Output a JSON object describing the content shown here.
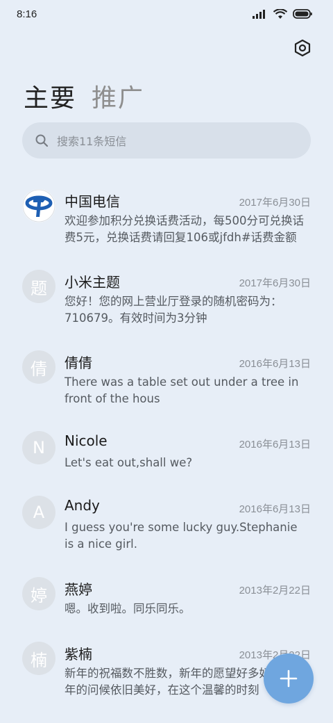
{
  "status_bar": {
    "time": "8:16"
  },
  "tabs": [
    {
      "label": "主要"
    },
    {
      "label": "推广"
    }
  ],
  "search": {
    "placeholder": "搜索11条短信"
  },
  "messages": [
    {
      "name": "中国电信",
      "date": "2017年6月30日",
      "preview": "欢迎参加积分兑换话费活动，每500分可兑换话费5元，兑换话费请回复106或jfdh#话费金额",
      "avatar": "china-telecom-logo"
    },
    {
      "name": "小米主题",
      "date": "2017年6月30日",
      "preview": "您好！您的网上营业厅登录的随机密码为：710679。有效时间为3分钟",
      "avatar": "题"
    },
    {
      "name": "倩倩",
      "date": "2016年6月13日",
      "preview": "There was a table set out under a tree in front of the hous",
      "avatar": "倩"
    },
    {
      "name": "Nicole",
      "date": "2016年6月13日",
      "preview": "Let's eat out,shall we?",
      "avatar": "N"
    },
    {
      "name": "Andy",
      "date": "2016年6月13日",
      "preview": "I guess you're some lucky guy.Stephanie is a nice girl.",
      "avatar": "A"
    },
    {
      "name": "燕婷",
      "date": "2013年2月22日",
      "preview": "嗯。收到啦。同乐同乐。",
      "avatar": "婷"
    },
    {
      "name": "紫楠",
      "date": "2013年2月22日",
      "preview": "新年的祝福数不胜数，新年的愿望好多好多，新年的问候依旧美好，在这个温馨的时刻",
      "avatar": "楠"
    }
  ],
  "colors": {
    "background": "#e7eef7",
    "fab": "#6fa6df",
    "telecom_blue": "#1e5fb3"
  }
}
